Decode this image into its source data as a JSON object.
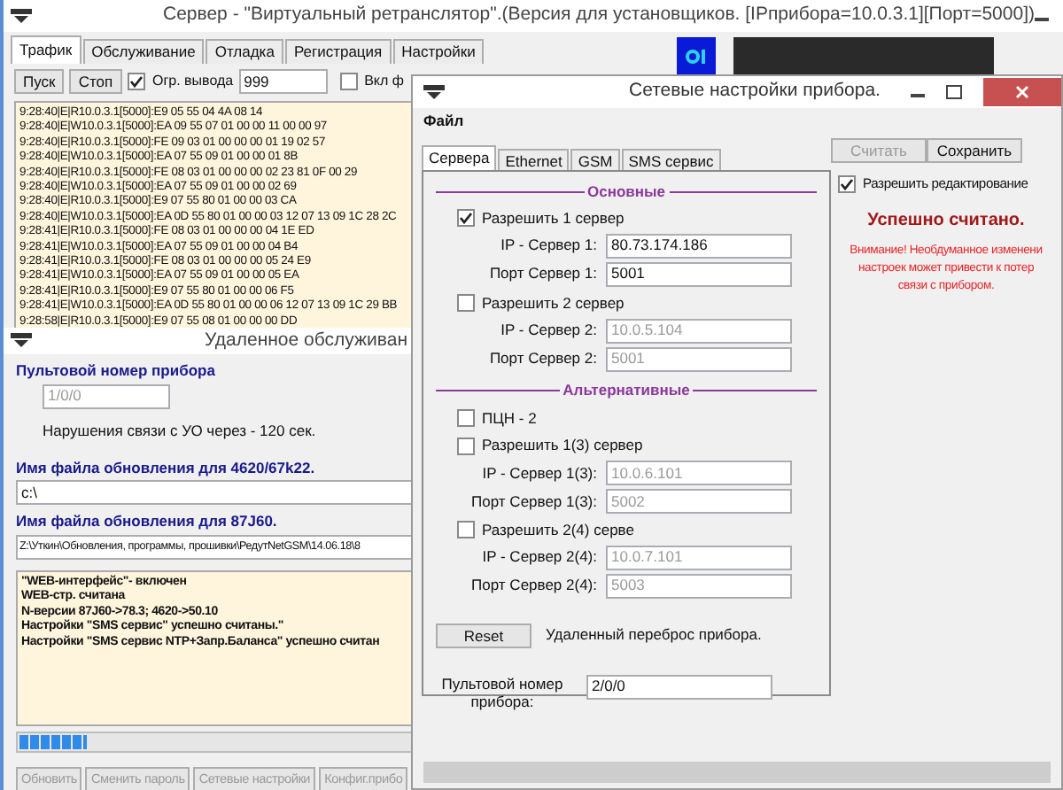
{
  "main_window": {
    "title": "Сервер - \"Виртуальный ретранслятор\".(Версия для установщиков. [IPприбора=10.0.3.1][Порт=5000])",
    "tabs": [
      {
        "label": "Трафик",
        "selected": true
      },
      {
        "label": "Обслуживание",
        "selected": false
      },
      {
        "label": "Отладка",
        "selected": false
      },
      {
        "label": "Регистрация",
        "selected": false
      },
      {
        "label": "Настройки",
        "selected": false
      }
    ],
    "toolbar": {
      "start": "Пуск",
      "stop": "Стоп",
      "limit": {
        "label": "Огр. вывода",
        "checked": true,
        "value": "999"
      },
      "filter": {
        "label": "Вкл ф",
        "checked": false
      }
    },
    "log": [
      "9:28:40|E|R10.0.3.1[5000]:E9 05 55 04 4A 08 14",
      "9:28:40|E|W10.0.3.1[5000]:EA 09 55 07 01 00 00 11 00 00 97",
      "9:28:40|E|R10.0.3.1[5000]:FE 09 03 01 00 00 00 01 19 02 57",
      "9:28:40|E|W10.0.3.1[5000]:EA 07 55 09 01 00 00 01 8B",
      "9:28:40|E|R10.0.3.1[5000]:FE 08 03 01 00 00 00 02 23 81 0F 00 29",
      "9:28:40|E|W10.0.3.1[5000]:EA 07 55 09 01 00 00 02 69",
      "9:28:40|E|R10.0.3.1[5000]:E9 07 55 80 01 00 00 03 CA",
      "9:28:40|E|W10.0.3.1[5000]:EA 0D 55 80 01 00 00 03 12 07 13 09 1C 28 2C",
      "9:28:41|E|R10.0.3.1[5000]:FE 08 03 01 00 00 00 04 1E ED",
      "9:28:41|E|W10.0.3.1[5000]:EA 07 55 09 01 00 00 04 B4",
      "9:28:41|E|R10.0.3.1[5000]:FE 08 03 01 00 00 00 05 24 E9",
      "9:28:41|E|W10.0.3.1[5000]:EA 07 55 09 01 00 00 05 EA",
      "9:28:41|E|R10.0.3.1[5000]:E9 07 55 80 01 00 00 06 F5",
      "9:28:41|E|W10.0.3.1[5000]:EA 0D 55 80 01 00 00 06 12 07 13 09 1C 29 BB",
      "9:28:58|E|R10.0.3.1[5000]:E9 07 55 08 01 00 00 00 DD"
    ]
  },
  "remote_window": {
    "title": "Удаленное обслуживан",
    "console_label": "Пультовой  номер прибора",
    "console_value": "1/0/0",
    "timeout_text": "Нарушения связи с УО через - 120 сек.",
    "file1_label": "Имя файла обновления для 4620/67k22.",
    "file1_value": "c:\\",
    "file2_label": "Имя файла обновления для 87J60.",
    "file2_value": "Z:\\Уткин\\Обновления, программы, прошивки\\РедутNetGSM\\14.06.18\\8",
    "messages": [
      "\"WEB-интерфейс\"- включен",
      "WEB-стр. считана",
      "N-версии 87J60->78.3; 4620->50.10",
      "Настройки \"SMS сервис\" успешно считаны.\"",
      "Настройки \"SMS сервис NTP+Запр.Баланса\" успешно считан"
    ],
    "progress": {
      "level": 0.17
    },
    "buttons": [
      {
        "label": "Обновить",
        "disabled": true
      },
      {
        "label": "Сменить пароль",
        "disabled": true
      },
      {
        "label": "Сетевые настройки",
        "disabled": true
      },
      {
        "label": "Конфиг.прибо",
        "disabled": true
      }
    ]
  },
  "dialog": {
    "title": "Сетевые настройки прибора.",
    "menu": [
      "Файл"
    ],
    "tabs": [
      {
        "label": "Сервера",
        "selected": true
      },
      {
        "label": "Ethernet",
        "selected": false
      },
      {
        "label": "GSM",
        "selected": false
      },
      {
        "label": "SMS сервис",
        "selected": false
      }
    ],
    "sections": [
      {
        "title": "Основные",
        "items": [
          {
            "kind": "server",
            "label": "Разрешить 1 сервер",
            "checked": true,
            "fields": [
              {
                "label": "IP - Сервер 1:",
                "value": "80.73.174.186",
                "disabled": false
              },
              {
                "label": "Порт Сервер 1:",
                "value": "5001",
                "disabled": false
              }
            ]
          },
          {
            "kind": "server",
            "label": "Разрешить 2 сервер",
            "checked": false,
            "fields": [
              {
                "label": "IP - Сервер 2:",
                "value": "10.0.5.104",
                "disabled": true
              },
              {
                "label": "Порт Сервер 2:",
                "value": "5001",
                "disabled": true
              }
            ]
          }
        ]
      },
      {
        "title": "Альтернативные",
        "items": [
          {
            "kind": "checkbox",
            "label": "ПЦН - 2",
            "checked": false
          },
          {
            "kind": "server",
            "label": "Разрешить 1(3) сервер",
            "checked": false,
            "fields": [
              {
                "label": "IP - Сервер 1(3):",
                "value": "10.0.6.101",
                "disabled": true
              },
              {
                "label": "Порт Сервер 1(3):",
                "value": "5002",
                "disabled": true
              }
            ]
          },
          {
            "kind": "server",
            "label": "Разрешить 2(4) серве",
            "checked": false,
            "fields": [
              {
                "label": "IP - Сервер 2(4):",
                "value": "10.0.7.101",
                "disabled": true
              },
              {
                "label": "Порт Сервер 2(4):",
                "value": "5003",
                "disabled": true
              }
            ]
          }
        ]
      }
    ],
    "reset": {
      "button": "Reset",
      "text": "Удаленный переброс прибора."
    },
    "console_number": {
      "label": "Пультовой номер прибора:",
      "value": "2/0/0"
    },
    "actions": [
      {
        "label": "Считать",
        "disabled": true
      },
      {
        "label": "Сохранить",
        "disabled": false
      }
    ],
    "allow_edit": {
      "label": "Разрешить редактирование",
      "checked": true
    },
    "status": "Успешно считано.",
    "warning": [
      "Внимание! Необдуманное изменени",
      "настроек может привести к потер",
      "связи с прибором."
    ]
  }
}
